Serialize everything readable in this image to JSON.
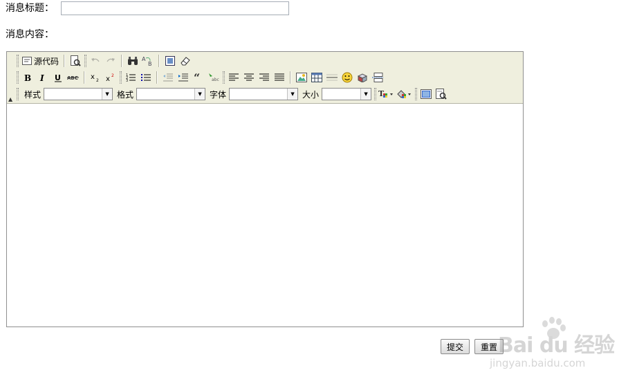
{
  "form": {
    "title_label": "消息标题：",
    "title_value": "",
    "content_label": "消息内容："
  },
  "editor": {
    "toolbar": {
      "row1": {
        "source_label": "源代码",
        "icons": [
          "source-icon",
          "preview-icon",
          "undo-icon",
          "redo-icon",
          "find-icon",
          "replace-icon",
          "select-all-icon",
          "remove-format-icon"
        ]
      },
      "row2": {
        "icons": [
          "bold-icon",
          "italic-icon",
          "underline-icon",
          "strikethrough-icon",
          "subscript-icon",
          "superscript-icon",
          "numbered-list-icon",
          "bulleted-list-icon",
          "outdent-icon",
          "indent-icon",
          "blockquote-icon",
          "link-icon",
          "align-left-icon",
          "align-center-icon",
          "align-right-icon",
          "justify-icon",
          "image-icon",
          "table-icon",
          "horizontal-rule-icon",
          "smiley-icon",
          "special-char-icon",
          "page-break-icon"
        ]
      },
      "row3": {
        "style_label": "样式",
        "style_value": "",
        "format_label": "格式",
        "format_value": "",
        "font_label": "字体",
        "font_value": "",
        "size_label": "大小",
        "size_value": "",
        "icons": [
          "text-color-icon",
          "background-color-icon",
          "maximize-icon",
          "show-blocks-icon"
        ]
      }
    },
    "content": ""
  },
  "buttons": {
    "submit_label": "提交",
    "reset_label": "重置"
  },
  "watermark": {
    "brand": "Bai  du 经验",
    "url": "jingyan.baidu.com"
  }
}
